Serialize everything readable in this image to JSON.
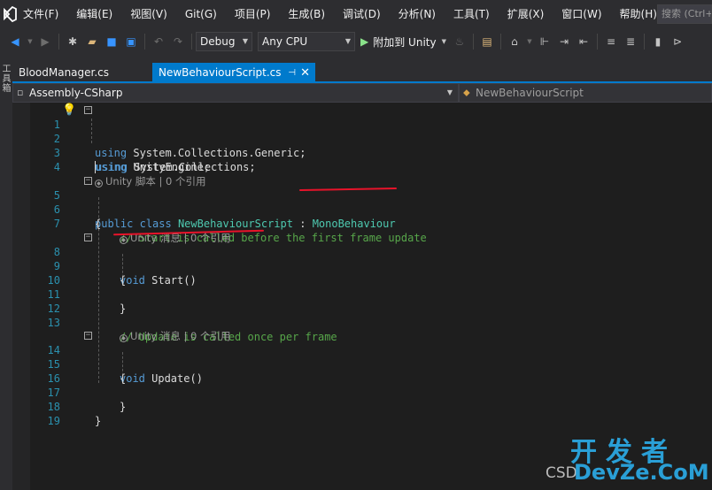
{
  "menubar": {
    "logo": "VS",
    "items": [
      "文件(F)",
      "编辑(E)",
      "视图(V)",
      "Git(G)",
      "项目(P)",
      "生成(B)",
      "调试(D)",
      "分析(N)",
      "工具(T)",
      "扩展(X)",
      "窗口(W)",
      "帮助(H)"
    ],
    "search_placeholder": "搜索 (Ctrl+"
  },
  "toolbar": {
    "configuration": "Debug",
    "platform": "Any CPU",
    "run_label": "附加到 Unity",
    "icons": [
      "back-icon",
      "forward-icon",
      "new-project-icon",
      "open-icon",
      "save-icon",
      "save-all-icon",
      "undo-icon",
      "redo-icon",
      "play-icon",
      "find-icon",
      "home-icon"
    ]
  },
  "left_strip": {
    "label": "工具箱"
  },
  "tabs": [
    {
      "label": "BloodManager.cs",
      "active": false
    },
    {
      "label": "NewBehaviourScript.cs",
      "active": true,
      "pin": "⊣",
      "close": "✕"
    }
  ],
  "navbar": {
    "project": "Assembly-CSharp",
    "type": "NewBehaviourScript"
  },
  "editor": {
    "line_numbers": [
      "1",
      "2",
      "3",
      "4",
      "5",
      "6",
      "7",
      "8",
      "9",
      "10",
      "11",
      "12",
      "13",
      "14",
      "15",
      "16",
      "17",
      "18",
      "19"
    ],
    "lines": {
      "l1": {
        "kw": "using",
        "rest": " System.Collections;"
      },
      "l2": {
        "kw": "using",
        "rest": " System.Collections.Generic;"
      },
      "l3": {
        "kw": "using",
        "rest": " UnityEngine;"
      },
      "lens_class": "Unity 脚本 | 0 个引用",
      "l5": {
        "kw1": "public",
        "kw2": "class",
        "name": "NewBehaviourScript",
        "sep": " : ",
        "base": "MonoBehaviour"
      },
      "l6": "{",
      "l7": "// Start is called before the first frame update",
      "lens_start": "Unity 消息 | 0 个引用",
      "l8": {
        "kw": "void",
        "rest": " Start()"
      },
      "l9": "{",
      "l11": "}",
      "l13": "// Update is called once per frame",
      "lens_update": "Unity 消息 | 0 个引用",
      "l14": {
        "kw": "void",
        "rest": " Update()"
      },
      "l15": "{",
      "l17": "}",
      "l18": "}"
    },
    "annotation_color": "#e8132a"
  },
  "watermark": {
    "cn": "开发者",
    "en": "DevZe.CoM",
    "csd": "CSD"
  }
}
